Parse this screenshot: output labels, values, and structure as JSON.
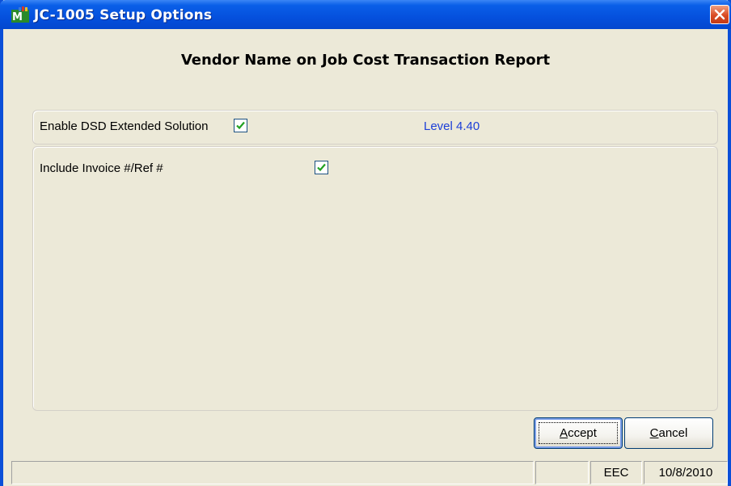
{
  "window": {
    "title": "JC-1005 Setup Options",
    "app_icon": "app-icon",
    "close_icon": "close-icon"
  },
  "heading": "Vendor Name on Job Cost Transaction Report",
  "options": {
    "enable_label": "Enable DSD Extended Solution",
    "enable_checked": true,
    "level_text": "Level  4.40",
    "include_invoice_label": "Include Invoice #/Ref #",
    "include_invoice_checked": true
  },
  "buttons": {
    "accept_hotkey": "A",
    "accept_rest": "ccept",
    "cancel_hotkey": "C",
    "cancel_rest": "ancel"
  },
  "statusbar": {
    "message": "",
    "company": "EEC",
    "date": "10/8/2010"
  },
  "colors": {
    "title_bar": "#0550dd",
    "level_text": "#1c3fd8",
    "check_mark": "#21a121",
    "window_bg": "#ece9d8"
  }
}
